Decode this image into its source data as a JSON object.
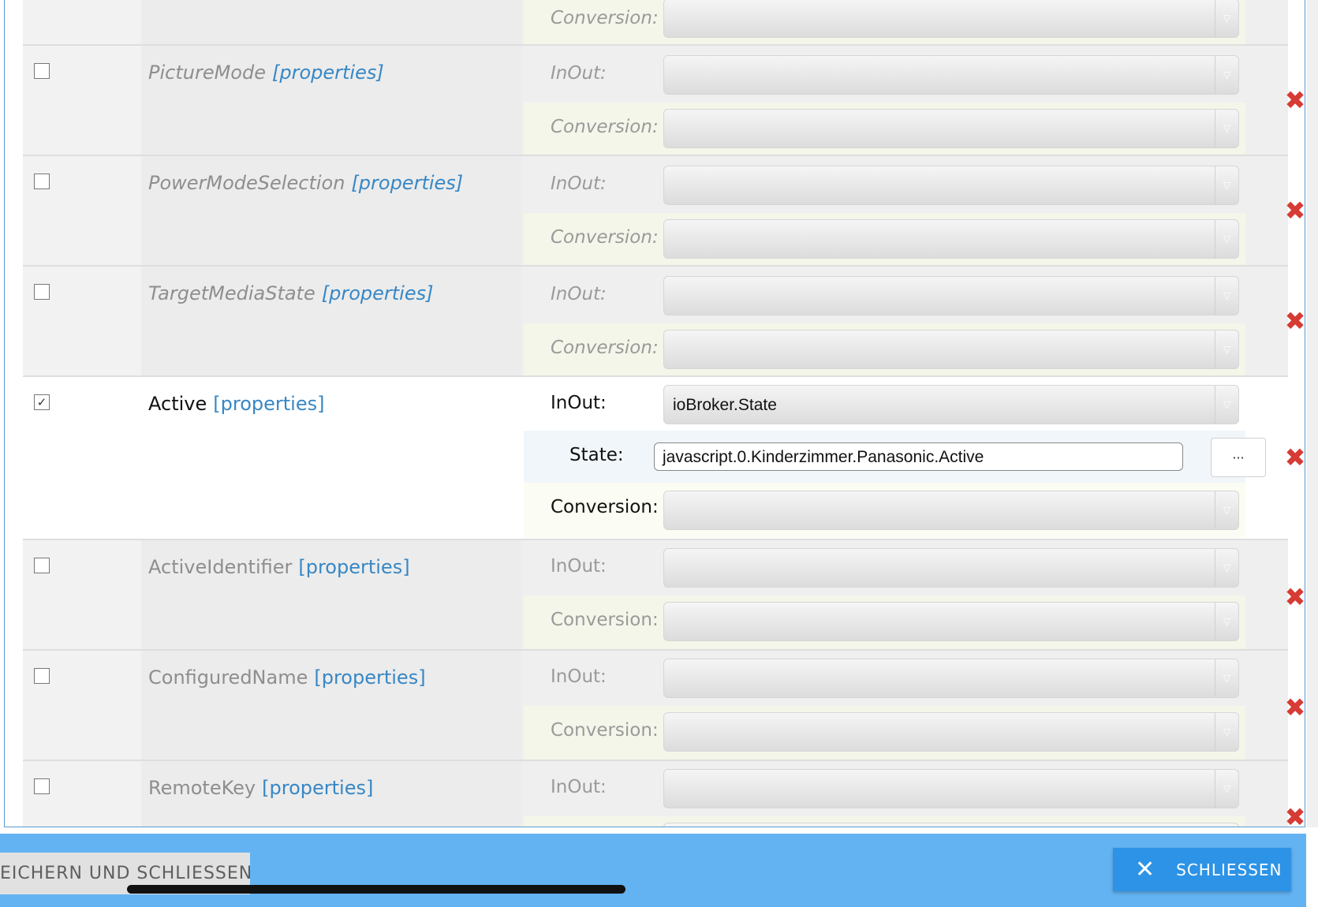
{
  "labels": {
    "inout": "InOut:",
    "conversion": "Conversion:",
    "state": "State:",
    "properties": "[properties]"
  },
  "rows": [
    {
      "name": "PictureMode",
      "checked": false
    },
    {
      "name": "PowerModeSelection",
      "checked": false
    },
    {
      "name": "TargetMediaState",
      "checked": false
    },
    {
      "name": "Active",
      "checked": true,
      "inout_value": "ioBroker.State",
      "state_value": "javascript.0.Kinderzimmer.Panasonic.Active"
    },
    {
      "name": "ActiveIdentifier",
      "checked": false
    },
    {
      "name": "ConfiguredName",
      "checked": false
    },
    {
      "name": "RemoteKey",
      "checked": false
    }
  ],
  "active_row": {
    "checkmark": "✓",
    "browse_button_label": "···"
  },
  "icons": {
    "delete": "close-x-red-icon",
    "dropdown": "chevron-down-icon",
    "close": "close-icon"
  },
  "delete_glyph": "✖",
  "dropdown_glyph": "▽",
  "footer": {
    "save_label": "EICHERN UND SCHLIESSEN",
    "close_label": "SCHLIESSEN",
    "close_glyph": "✕"
  },
  "colors": {
    "accent": "#2d93e6",
    "footer_bg": "#63b3f3",
    "delete": "#d63b34",
    "link": "#3787c5"
  }
}
